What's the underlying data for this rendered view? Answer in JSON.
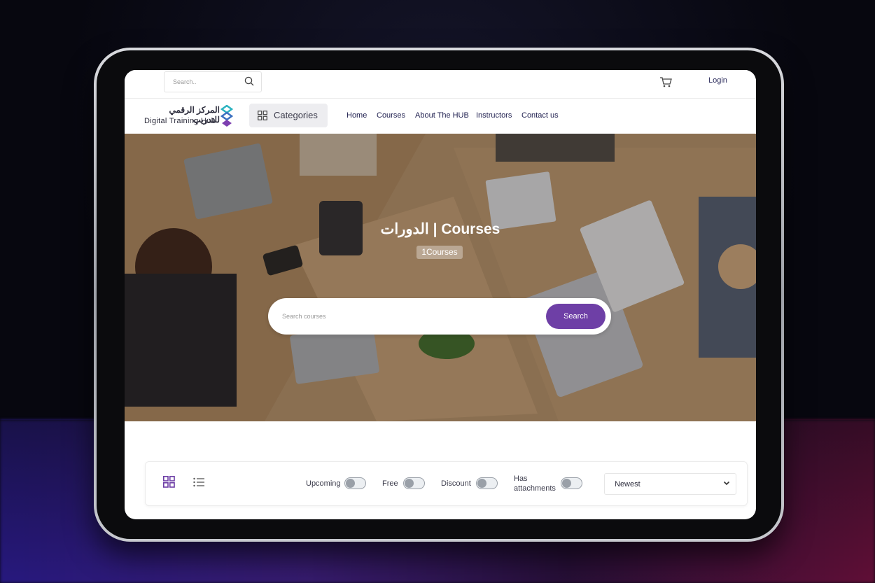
{
  "top": {
    "search_placeholder": "Search..",
    "login_label": "Login"
  },
  "brand": {
    "name_ar": "المركز الرقمي للتدريب",
    "name_en": "Digital Training Hub"
  },
  "nav": {
    "categories_label": "Categories",
    "links": [
      "Home",
      "Courses",
      "About The HUB",
      "Instructors",
      "Contact us"
    ]
  },
  "hero": {
    "title": "الدورات | Courses",
    "count_label": "1Courses",
    "search_placeholder": "Search courses",
    "search_button": "Search"
  },
  "filters": {
    "upcoming_label": "Upcoming",
    "free_label": "Free",
    "discount_label": "Discount",
    "attachments_label_1": "Has",
    "attachments_label_2": "attachments",
    "sort_value": "Newest"
  },
  "colors": {
    "accent": "#6e3fa6",
    "nav_text": "#1f1f4f"
  },
  "icons": [
    "search-icon",
    "cart-icon",
    "grid-icon",
    "list-icon",
    "chevron-down-icon"
  ]
}
